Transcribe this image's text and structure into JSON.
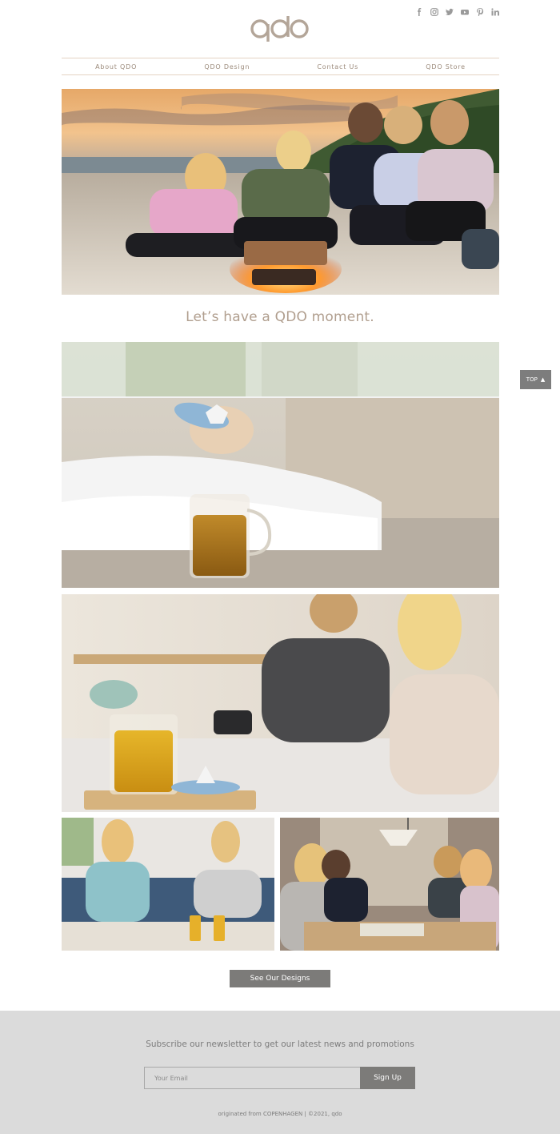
{
  "social": {
    "icons": [
      "facebook-icon",
      "instagram-icon",
      "twitter-icon",
      "youtube-icon",
      "pinterest-icon",
      "linkedin-icon"
    ],
    "color": "#9a9a9a"
  },
  "brand": {
    "logo_text": "qdo",
    "logo_color": "#b3a598"
  },
  "nav": {
    "items": [
      "About QDO",
      "QDO Design",
      "Contact Us",
      "QDO Store"
    ],
    "border_color": "#e4d3c3"
  },
  "images": {
    "hero": "beach-bonfire-friends-photo",
    "tea_bed": "tea-infuser-bedroom-photo",
    "couple_couch": "couple-tea-tray-photo",
    "friends_sofa": "friends-sofa-tea-photo",
    "board_game": "friends-board-game-photo"
  },
  "tagline": "Let’s have a QDO moment.",
  "top_button": {
    "label": "TOP",
    "icon": "chevron-up-icon"
  },
  "cta": {
    "label": "See Our Designs"
  },
  "footer": {
    "headline": "Subscribe our newsletter to get our latest news and promotions",
    "email_placeholder": "Your Email",
    "signup_label": "Sign Up",
    "credit": "originated from COPENHAGEN  |  ©2021, qdo",
    "background": "#dbdbdb"
  },
  "colors": {
    "accent": "#b09e8e",
    "button": "#7c7b79"
  }
}
